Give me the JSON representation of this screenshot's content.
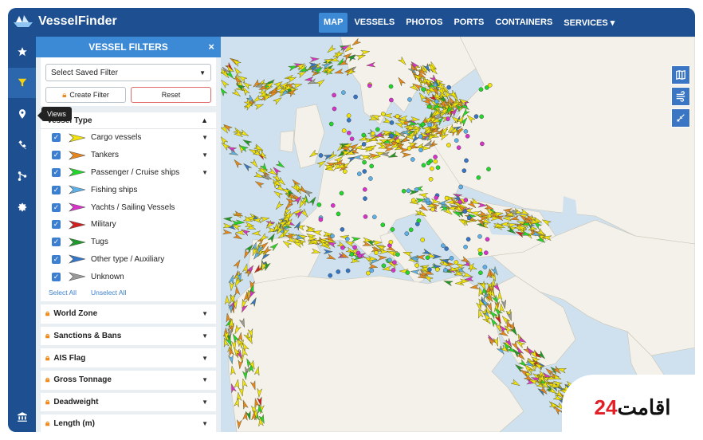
{
  "app": {
    "logo_text": "VesselFinder"
  },
  "nav": [
    {
      "label": "MAP",
      "active": true
    },
    {
      "label": "VESSELS"
    },
    {
      "label": "PHOTOS"
    },
    {
      "label": "PORTS"
    },
    {
      "label": "CONTAINERS"
    },
    {
      "label": "SERVICES ▾"
    }
  ],
  "sidebar": {
    "items": [
      "star-icon",
      "filter-icon",
      "map-pin-icon",
      "satellite-icon",
      "route-icon",
      "settings-icon",
      "bank-icon"
    ],
    "tooltip": "Views"
  },
  "panel": {
    "title": "VESSEL FILTERS",
    "close": "×",
    "saved_filter_placeholder": "Select Saved Filter",
    "create_filter": "Create Filter",
    "reset": "Reset",
    "vessel_type_title": "Vessel Type",
    "vessel_types": [
      {
        "label": "Cargo vessels",
        "color": "#f2e40a",
        "expand": true
      },
      {
        "label": "Tankers",
        "color": "#e8861e",
        "expand": true
      },
      {
        "label": "Passenger / Cruise ships",
        "color": "#22d62a",
        "expand": true
      },
      {
        "label": "Fishing ships",
        "color": "#5db0e8",
        "expand": false
      },
      {
        "label": "Yachts / Sailing Vessels",
        "color": "#d833c9",
        "expand": false
      },
      {
        "label": "Military",
        "color": "#d01f1f",
        "expand": false
      },
      {
        "label": "Tugs",
        "color": "#1f9a2a",
        "expand": false
      },
      {
        "label": "Other type / Auxiliary",
        "color": "#3575c6",
        "expand": false
      },
      {
        "label": "Unknown",
        "color": "#9a9a9a",
        "expand": false
      }
    ],
    "select_all": "Select All",
    "unselect_all": "Unselect All",
    "sections": [
      "World Zone",
      "Sanctions & Bans",
      "AIS Flag",
      "Gross Tonnage",
      "Deadweight",
      "Length (m)"
    ]
  },
  "map_tools": [
    "map-layers-icon",
    "wind-icon",
    "measure-icon"
  ],
  "watermark": {
    "text_main": "اقامت",
    "text_num": "24"
  },
  "colors": {
    "topbar": "#1d4f91",
    "accent": "#3c8ad6",
    "sea": "#cfe1ee",
    "land": "#f3f1ea"
  }
}
